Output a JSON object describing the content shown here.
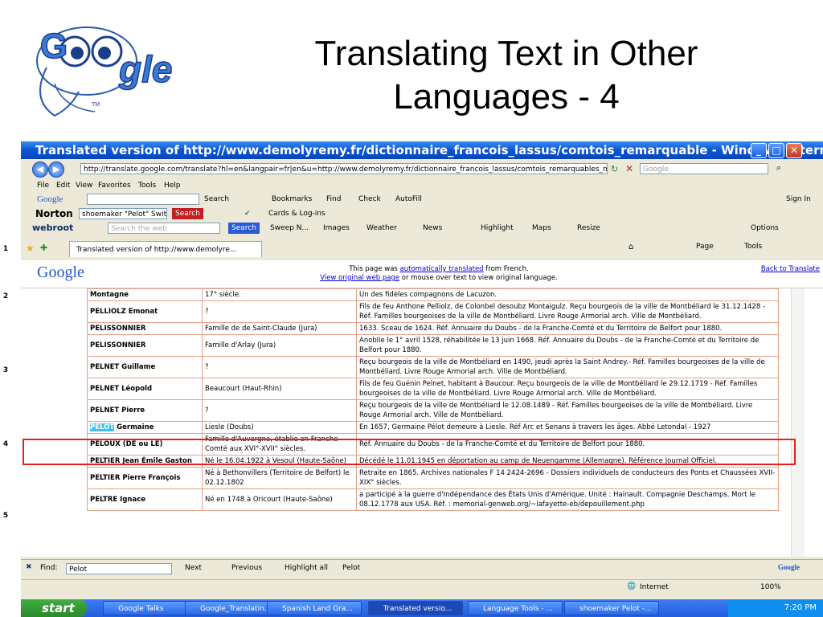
{
  "slide": {
    "title_line1": "Translating Text in Other",
    "title_line2": "Languages - 4"
  },
  "logo": {
    "text": "Google",
    "tm": "TM"
  },
  "ppt_left": [
    "1",
    "2",
    "3",
    "4",
    "5"
  ],
  "window": {
    "title": "Translated version of http://www.demolyremy.fr/dictionnaire_francois_lassus/comtois_remarquable - Windows Internet Explo...",
    "address": "http://translate.google.com/translate?hl=en&langpair=fr|en&u=http://www.demolyremy.fr/dictionnaire_francois_lassus/comtois_remarquables_n",
    "search_placeholder": "Google",
    "menu": [
      "File",
      "Edit",
      "View",
      "Favorites",
      "Tools",
      "Help"
    ],
    "google_toolbar": {
      "search": "Search",
      "bookmarks": "Bookmarks",
      "find": "Find",
      "check": "Check",
      "autofill": "AutoFill",
      "signin": "Sign In"
    },
    "norton": {
      "label": "Norton",
      "field": "shoemaker \"Pelot\" Swit:",
      "search": "Search",
      "cards": "Cards & Log-ins"
    },
    "webroot": {
      "label": "webroot",
      "field_placeholder": "Search the web",
      "search": "Search",
      "items": [
        "Sweep N...",
        "Images",
        "Weather",
        "News",
        "Highlight",
        "Maps",
        "Resize"
      ],
      "options": "Options"
    },
    "tab": {
      "label": "Translated version of http://www.demolyre...",
      "page": "Page",
      "tools": "Tools"
    },
    "gt": {
      "logo": "Google",
      "info1_pre": "This page was ",
      "info1_link": "automatically translated",
      "info1_post": " from French.",
      "info2_link": "View original web page",
      "info2_post": " or mouse over text to view original language.",
      "back": "Back to Translate"
    },
    "rows": [
      {
        "name": "Montagne",
        "origin": "17° siècle.",
        "desc": "Un des fidèles compagnons de Lacuzon."
      },
      {
        "name": "PELLIOLZ Emonat",
        "origin": "?",
        "desc": "Fils de feu Anthone Pelliolz, de Colonbel desoubz Montaigulz. Reçu bourgeois de la ville de Montbéliard le 31.12.1428 - Réf. Familles bourgeoises de la ville de Montbéliard. Livre Rouge Armorial arch. Ville de Montbéliard."
      },
      {
        "name": "PELISSONNIER",
        "origin": "Famille de de Saint-Claude (Jura)",
        "desc": "1633. Sceau de 1624. Réf. Annuaire du Doubs - de la Franche-Comté et du Territoire de Belfort pour 1880."
      },
      {
        "name": "PELISSONNIER",
        "origin": "Famille d'Arlay (Jura)",
        "desc": "Anoblie le 1° avril 1528, réhabilitée le 13 juin 1668. Réf. Annuaire du Doubs - de la Franche-Comté et du Territoire de Belfort pour 1880."
      },
      {
        "name": "PELNET Guillame",
        "origin": "?",
        "desc": "Reçu bourgeois de la ville de Montbéliard en 1490, jeudi après la Saint Andrey.- Réf. Familles bourgeoises de la ville de Montbéliard. Livre Rouge Armorial arch. Ville de Montbéliard."
      },
      {
        "name": "PELNET Léopold",
        "origin": "Beaucourt (Haut-Rhin)",
        "desc": "Fils de feu Guénin Pelnet, habitant à Baucour. Reçu bourgeois de la ville de Montbéliard le 29.12.1719 - Réf. Familles bourgeoises de la ville de Montbéliard. Livre Rouge Armorial arch. Ville de Montbéliard."
      },
      {
        "name": "PELNET Pierre",
        "origin": "?",
        "desc": "Reçu bourgeois de la ville de Montbéliard le 12.08.1489 - Réf. Familles bourgeoises de la ville de Montbéliard. Livre Rouge Armorial arch. Ville de Montbéliard."
      },
      {
        "name_hl": "PELOT",
        "name_rest": " Germaine",
        "origin": "Liesle (Doubs)",
        "desc": "En 1657, Germaine Pélot demeure à Liesle. Réf Arc et Senans à travers les âges. Abbé Letondal - 1927"
      },
      {
        "name": "PELOUX (DE ou LE)",
        "origin": "Famille d'Auvergne, établie en Franche-Comté aux XVI°-XVII° siècles.",
        "desc": "Réf. Annuaire du Doubs - de la Franche-Comté et du Territoire de Belfort pour 1880."
      },
      {
        "name": "PELTIER Jean Émile Gaston",
        "origin": "Né le 16.04.1922 à Vesoul (Haute-Saône)",
        "desc": "Décédé le 11.01.1945 en déportation au camp de Neuengamme (Allemagne). Référence Journal Officiel."
      },
      {
        "name": "PELTIER Pierre François",
        "origin": "Né à Bethonvillers (Territoire de Belfort) le 02.12.1802",
        "desc": "Retraite en 1865. Archives nationales F 14 2424-2696 - Dossiers individuels de conducteurs des Ponts et Chaussées XVII-XIX° siècles."
      },
      {
        "name": "PELTRE Ignace",
        "origin": "Né en 1748 à Oricourt (Haute-Saône)",
        "desc": "a participé à la guerre d'Indépendance des États Unis d'Amérique. Unité : Hainault. Compagnie Deschamps. Mort le 08.12.1778 aux USA. Réf. : memorial-genweb.org/~lafayette-eb/depouillement.php"
      }
    ],
    "findbar": {
      "label": "Find:",
      "value": "Pelot",
      "next": "Next",
      "previous": "Previous",
      "highlight": "Highlight all",
      "match": "Pelot",
      "brand": "Google"
    },
    "status": {
      "zone": "Internet",
      "zoom": "100%"
    },
    "taskbar": {
      "start": "start",
      "tasks": [
        "Google Talks",
        "Google_Translatin...",
        "Spanish Land Gra...",
        "Translated versio...",
        "Language Tools - ...",
        "shoemaker Pelot -..."
      ],
      "time": "7:20 PM"
    }
  }
}
